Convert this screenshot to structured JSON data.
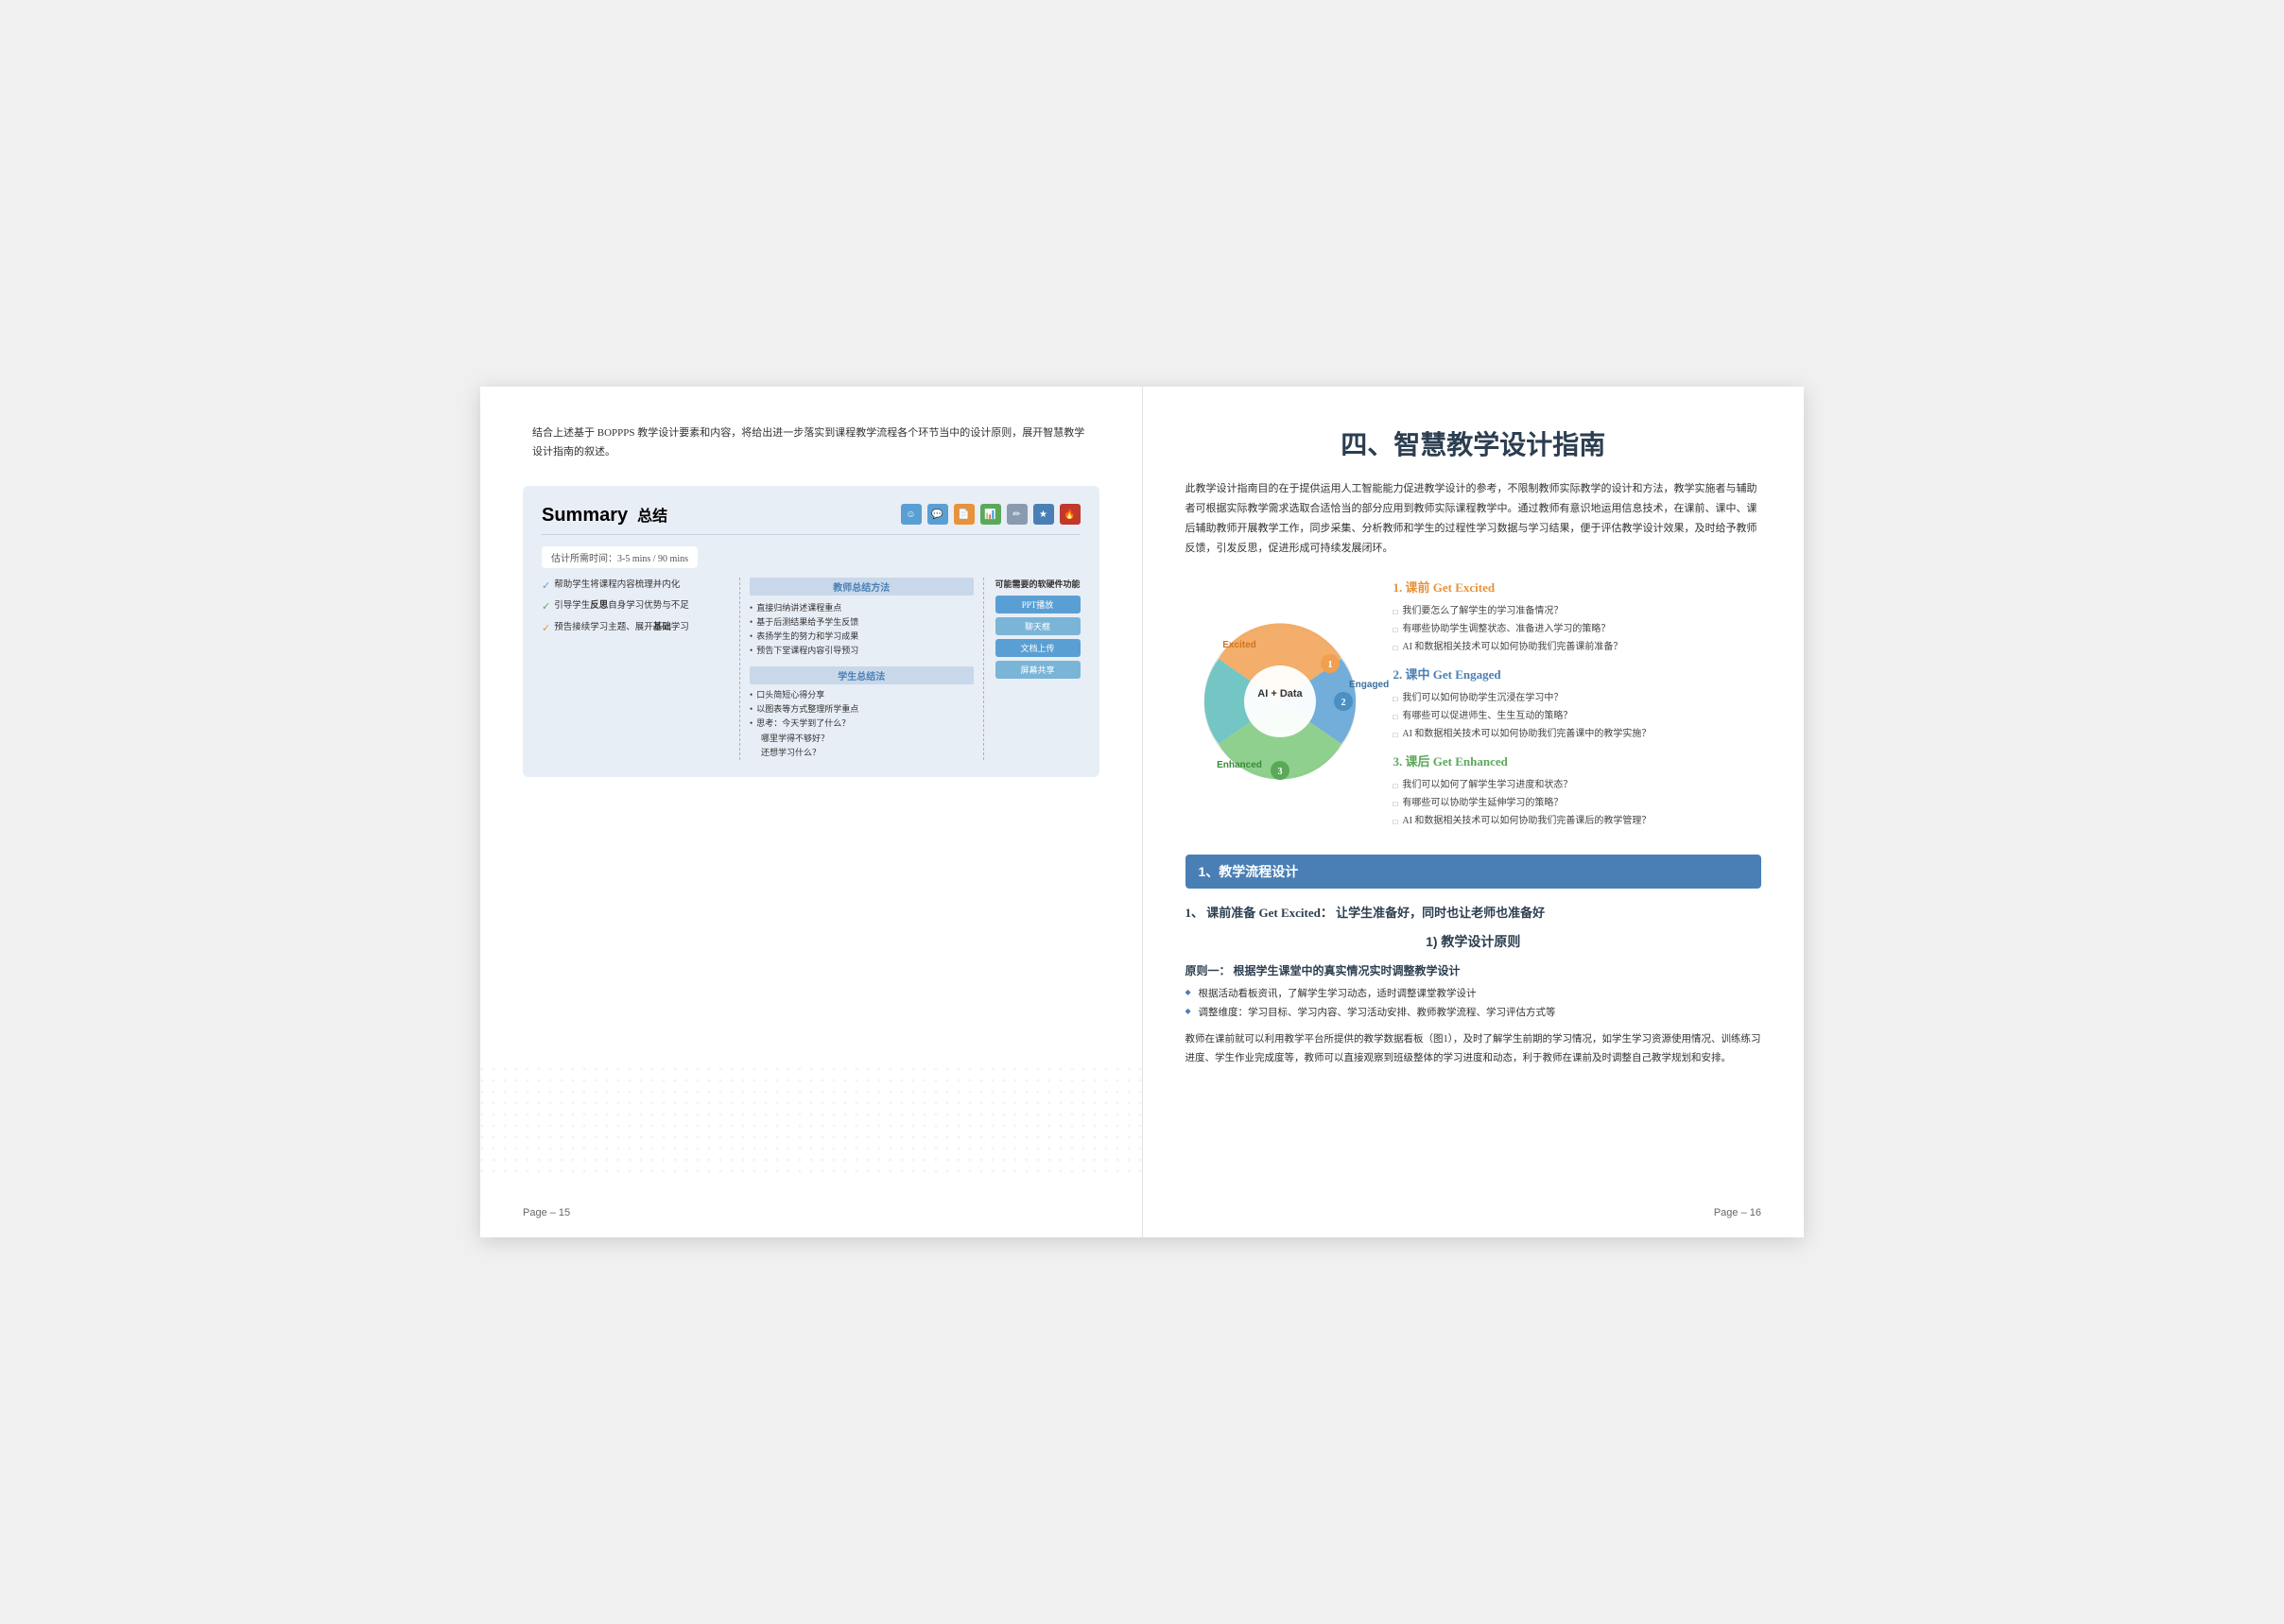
{
  "left_page": {
    "intro": "结合上述基于 BOPPPS 教学设计要素和内容，将给出进一步落实到课程教学流程各个环节当中的设计原则，展开智慧教学设计指南的叙述。",
    "summary": {
      "title_en": "Summary",
      "title_zh": "总结",
      "time_label": "估计所需时间：3-5 mins / 90 mins",
      "check_items": [
        "帮助学生将课程内容梳理并内化",
        "引导学生反思自身学习优势与不足",
        "预告接续学习主题、展开基础学习"
      ],
      "teacher_method_title": "教师总结方法",
      "teacher_methods": [
        "• 直接归纳讲述课程重点",
        "• 基于后测结果给予学生反馈",
        "• 表扬学生的努力和学习成果",
        "• 预告下堂课程内容引导预习"
      ],
      "student_method_title": "学生总结法",
      "student_methods": [
        "• 口头简短心得分享",
        "• 以图表等方式整理所学重点",
        "• 思考：今天学到了什么？哪里学得不够好？还想学习什么？"
      ],
      "software_title": "可能需要的软硬件功能",
      "software_items": [
        "PPT播放",
        "聊天框",
        "文档上传",
        "屏幕共享"
      ]
    },
    "page_num": "Page – 15"
  },
  "right_page": {
    "title": "四、智慧教学设计指南",
    "intro": "此教学设计指南目的在于提供运用人工智能能力促进教学设计的参考，不限制教师实际教学的设计和方法，教学实施者与辅助者可根据实际教学需求选取合适恰当的部分应用到教师实际课程教学中。通过教师有意识地运用信息技术，在课前、课中、课后辅助教师开展教学工作，同步采集、分析教师和学生的过程性学习数据与学习结果，便于评估教学设计效果，及时给予教师反馈，引发反思，促进形成可持续发展闭环。",
    "diagram": {
      "center_line1": "AI + Data",
      "excited": "Excited",
      "engaged": "Engaged",
      "enhanced": "Enhanced"
    },
    "sections": [
      {
        "num": "1.",
        "title": "课前 Get Excited",
        "color": "orange",
        "items": [
          "我们要怎么了解学生的学习准备情况？",
          "有哪些协助学生调整状态、准备进入学习的策略？",
          "AI 和数据相关技术可以如何协助我们完善课前准备？"
        ]
      },
      {
        "num": "2.",
        "title": "课中 Get Engaged",
        "color": "blue",
        "items": [
          "我们可以如何协助学生沉浸在学习中？",
          "有哪些可以促进师生、生生互动的策略？",
          "AI 和数据相关技术可以如何协助我们完善课中的教学实施？"
        ]
      },
      {
        "num": "3.",
        "title": "课后 Get Enhanced",
        "color": "green",
        "items": [
          "我们可以如何了解学生学习进度和状态？",
          "有哪些可以协助学生延伸学习的策略？",
          "AI 和数据相关技术可以如何协助我们完善课后的教学管理？"
        ]
      }
    ],
    "bottom_section": {
      "title": "1、教学流程设计",
      "subsection": "1、 课前准备 Get Excited： 让学生准备好，同时也让老师也准备好",
      "subtitle": "1) 教学设计原则",
      "principle": "原则一： 根据学生课堂中的真实情况实时调整教学设计",
      "bullets": [
        "◆根据活动看板资讯，了解学生学习动态，适时调整课堂教学设计",
        "◆调整维度：学习目标、学习内容、学习活动安排、教师教学流程、学习评估方式等"
      ],
      "body_text": "教师在课前就可以利用教学平台所提供的教学数据看板（图1），及时了解学生前期的学习情况，如学生学习资源使用情况、训练练习进度、学生作业完成度等，教师可以直接观察到班级整体的学习进度和动态，利于教师在课前及时调整自己教学规划和安排。"
    },
    "page_num": "Page – 16"
  }
}
